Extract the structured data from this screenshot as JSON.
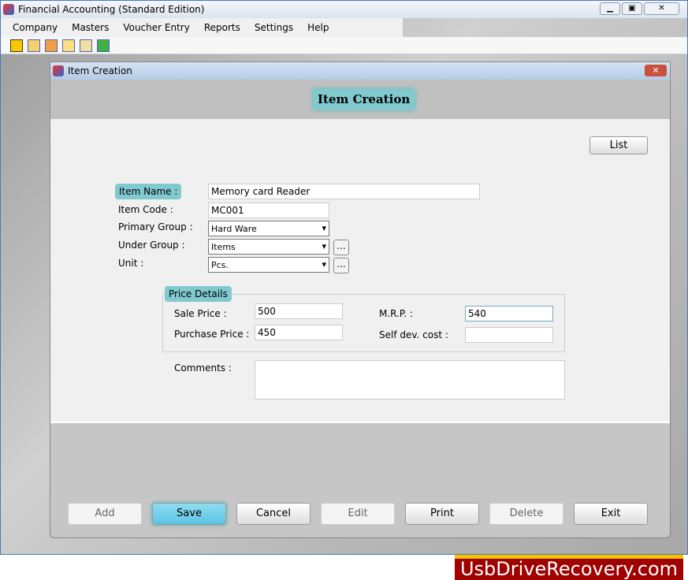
{
  "app": {
    "title": "Financial Accounting (Standard Edition)",
    "menu": [
      "Company",
      "Masters",
      "Voucher Entry",
      "Reports",
      "Settings",
      "Help"
    ]
  },
  "window": {
    "title": "Item Creation",
    "heading": "Item Creation",
    "list_label": "List"
  },
  "form": {
    "item_name_label": "Item Name :",
    "item_name": "Memory card Reader",
    "item_code_label": "Item Code :",
    "item_code": "MC001",
    "primary_group_label": "Primary Group :",
    "primary_group": "Hard Ware",
    "under_group_label": "Under Group :",
    "under_group": "Items",
    "unit_label": "Unit :",
    "unit": "Pcs.",
    "browse": "...",
    "price_details": "Price Details",
    "sale_price_label": "Sale Price :",
    "sale_price": "500",
    "purchase_price_label": "Purchase Price :",
    "purchase_price": "450",
    "mrp_label": "M.R.P. :",
    "mrp": "540",
    "self_dev_label": "Self dev. cost :",
    "self_dev": "",
    "comments_label": "Comments :",
    "comments": ""
  },
  "buttons": {
    "add": "Add",
    "save": "Save",
    "cancel": "Cancel",
    "edit": "Edit",
    "print": "Print",
    "delete": "Delete",
    "exit": "Exit"
  },
  "brand": "UsbDriveRecovery.com"
}
